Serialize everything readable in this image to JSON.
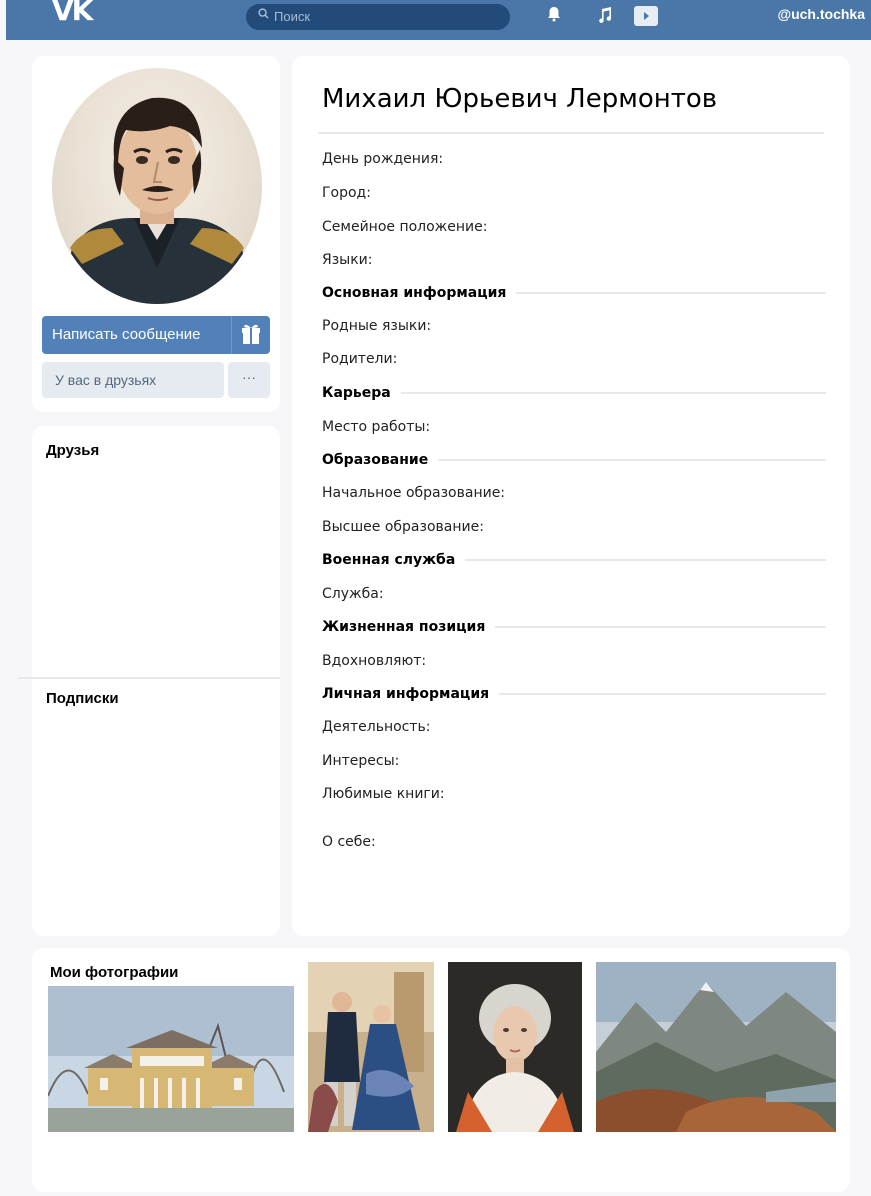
{
  "header": {
    "search_placeholder": "Поиск",
    "username": "@uch.tochka",
    "icons": [
      "vk-logo-icon",
      "search-icon",
      "bell-icon",
      "music-icon",
      "video-icon"
    ]
  },
  "profile": {
    "send_message_label": "Написать сообщение",
    "friend_status_label": "У вас в друзьях",
    "more_label": "···"
  },
  "sidebar": {
    "friends_title": "Друзья",
    "subscriptions_title": "Подписки"
  },
  "info": {
    "name": "Михаил Юрьевич Лермонтов",
    "fields_top": [
      "День рождения:",
      "Город:",
      "Семейное положение:",
      "Языки:"
    ],
    "sections": [
      {
        "title": "Основная информация",
        "fields": [
          "Родные языки:",
          "Родители:"
        ]
      },
      {
        "title": "Карьера",
        "fields": [
          "Место работы:"
        ]
      },
      {
        "title": "Образование",
        "fields": [
          "Начальное образование:",
          "Высшее образование:"
        ]
      },
      {
        "title": "Военная служба",
        "fields": [
          "Служба:"
        ]
      },
      {
        "title": "Жизненная позиция",
        "fields": [
          "Вдохновляют:"
        ]
      },
      {
        "title": "Личная информация",
        "fields": [
          "Деятельность:",
          "Интересы:",
          "Любимые книги:"
        ]
      }
    ],
    "about_label": "О себе:"
  },
  "photos": {
    "title": "Мои фотографии"
  },
  "colors": {
    "header_bg": "#4a76a8",
    "accent": "#5181b8",
    "page_bg": "#f7f7f9"
  }
}
